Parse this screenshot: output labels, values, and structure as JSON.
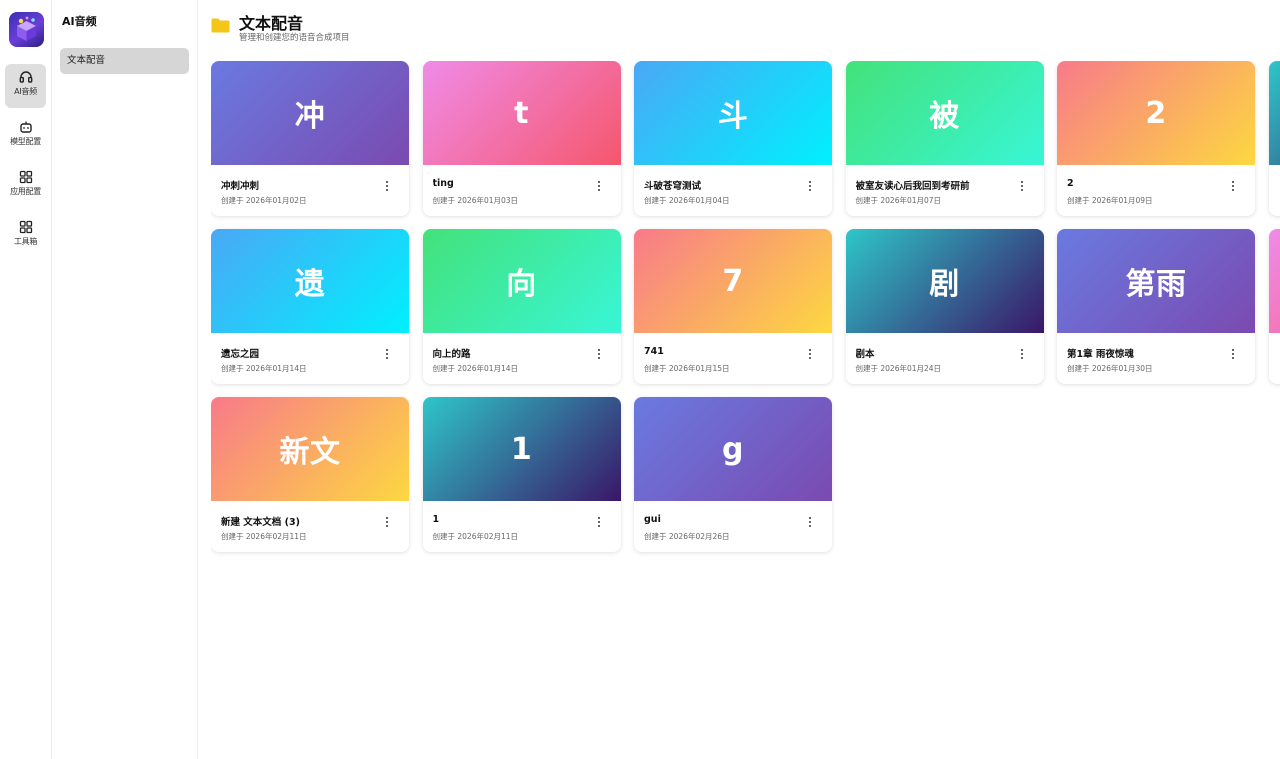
{
  "rail": {
    "items": [
      {
        "label": "AI音频",
        "icon": "headphones-icon",
        "active": true
      },
      {
        "label": "模型配置",
        "icon": "robot-icon",
        "active": false
      },
      {
        "label": "应用配置",
        "icon": "grid-icon",
        "active": false
      },
      {
        "label": "工具箱",
        "icon": "grid-icon",
        "active": false
      }
    ]
  },
  "sidebar": {
    "title": "AI音频",
    "items": [
      {
        "label": "文本配音",
        "active": true
      }
    ]
  },
  "header": {
    "title": "文本配音",
    "subtitle": "管理和创建您的语音合成项目",
    "icon": "folder-icon",
    "icon_color": "#f5c518"
  },
  "projects": [
    {
      "thumb": "冲",
      "name": "冲刺冲刺",
      "date": "创建于 2026年01月02日",
      "gradient": "purple"
    },
    {
      "thumb": "t",
      "name": "ting",
      "date": "创建于 2026年01月03日",
      "gradient": "pink"
    },
    {
      "thumb": "斗",
      "name": "斗破苍穹测试",
      "date": "创建于 2026年01月04日",
      "gradient": "blue"
    },
    {
      "thumb": "被",
      "name": "被室友读心后我回到考研前",
      "date": "创建于 2026年01月07日",
      "gradient": "green"
    },
    {
      "thumb": "2",
      "name": "2",
      "date": "创建于 2026年01月09日",
      "gradient": "orange"
    },
    {
      "thumb": "遗",
      "name": "遗忘之园",
      "date": "创建于 2026年01月14日",
      "gradient": "blue"
    },
    {
      "thumb": "向",
      "name": "向上的路",
      "date": "创建于 2026年01月14日",
      "gradient": "green"
    },
    {
      "thumb": "7",
      "name": "741",
      "date": "创建于 2026年01月15日",
      "gradient": "orange"
    },
    {
      "thumb": "剧",
      "name": "剧本",
      "date": "创建于 2026年01月24日",
      "gradient": "teal"
    },
    {
      "thumb": "第雨",
      "name": "第1章 雨夜惊魂",
      "date": "创建于 2026年01月30日",
      "gradient": "purple"
    },
    {
      "thumb": "新文",
      "name": "新建 文本文档 (3)",
      "date": "创建于 2026年02月11日",
      "gradient": "orange"
    },
    {
      "thumb": "1",
      "name": "1",
      "date": "创建于 2026年02月11日",
      "gradient": "teal"
    },
    {
      "thumb": "g",
      "name": "gui",
      "date": "创建于 2026年02月26日",
      "gradient": "purple"
    }
  ],
  "partial_cards": [
    {
      "gradient": "teal"
    },
    {
      "gradient": "pink"
    }
  ]
}
